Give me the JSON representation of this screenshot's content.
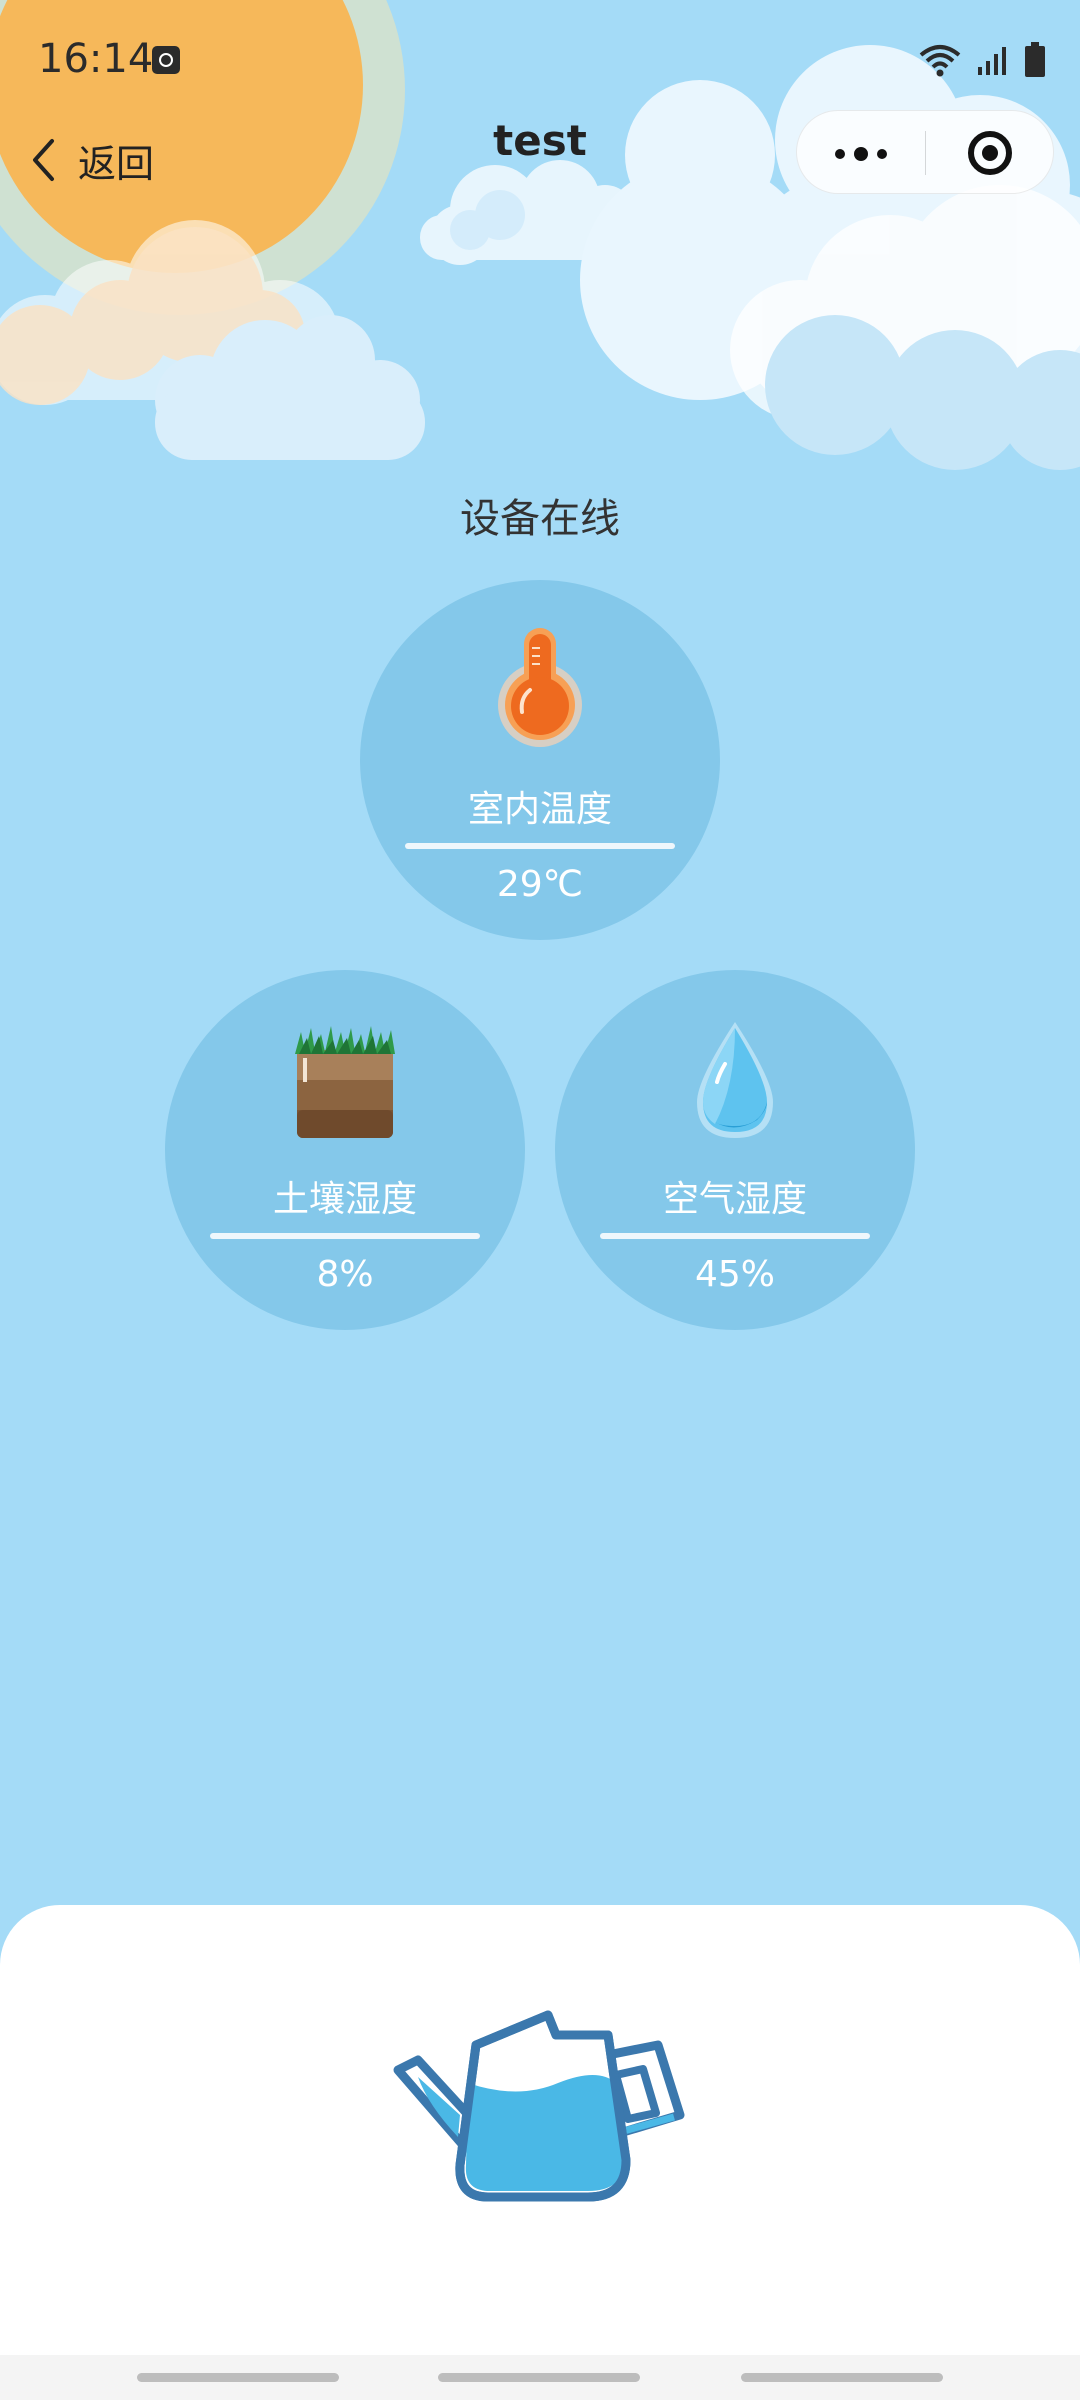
{
  "status_bar": {
    "time": "16:14"
  },
  "nav": {
    "back_label": "返回",
    "title": "test"
  },
  "device_status": "设备在线",
  "sensors": [
    {
      "label": "室内温度",
      "value": "29℃",
      "icon": "thermometer-icon"
    },
    {
      "label": "土壤湿度",
      "value": "8%",
      "icon": "soil-icon"
    },
    {
      "label": "空气湿度",
      "value": "45%",
      "icon": "water-drop-icon"
    }
  ],
  "actions": {
    "water_icon": "watering-can-icon"
  },
  "colors": {
    "sky": "#a4dbf7",
    "circle": "#84c8ea",
    "sun": "#f6b85a",
    "water": "#4ab8e6",
    "outline": "#3b78ad"
  }
}
